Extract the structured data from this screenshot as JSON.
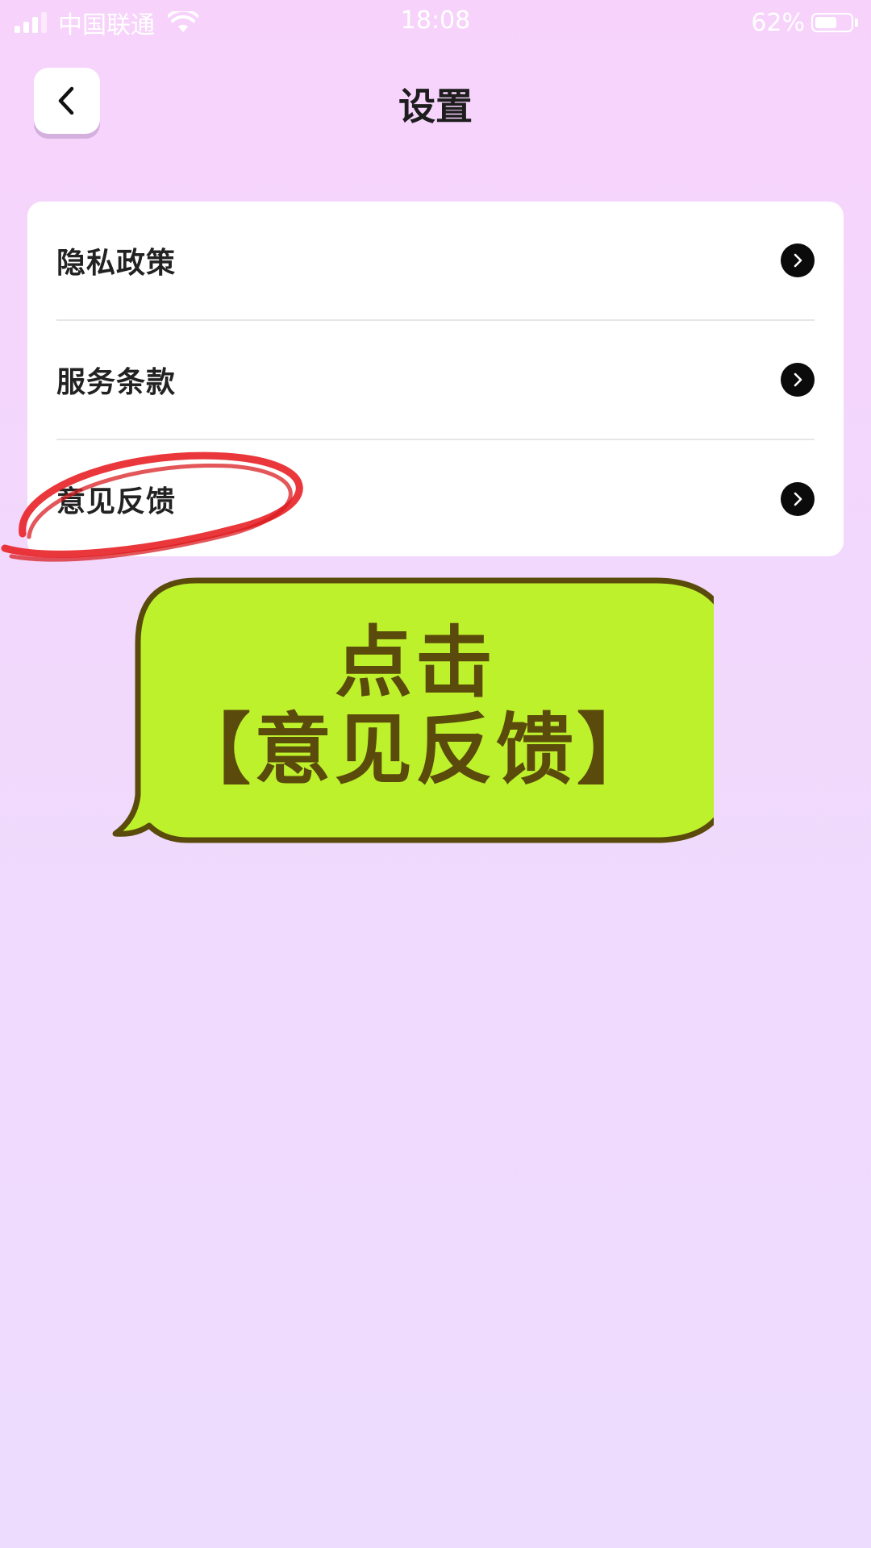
{
  "status_bar": {
    "carrier": "中国联通",
    "time": "18:08",
    "battery_percent": "62%",
    "battery_level": 0.62,
    "icons": [
      "signal-icon",
      "wifi-icon",
      "battery-icon"
    ]
  },
  "header": {
    "title": "设置",
    "back_icon": "chevron-left-icon"
  },
  "settings": {
    "items": [
      {
        "label": "隐私政策",
        "icon": "chevron-right-icon"
      },
      {
        "label": "服务条款",
        "icon": "chevron-right-icon"
      },
      {
        "label": "意见反馈",
        "icon": "chevron-right-icon"
      }
    ]
  },
  "callout": {
    "line1": "点击",
    "line2": "【意见反馈】"
  },
  "colors": {
    "background_top": "#f7d3fb",
    "background_bottom": "#eedcff",
    "card": "#ffffff",
    "bubble_fill": "#bdf12c",
    "bubble_outline": "#5a4a0b",
    "highlight": "#e8262a",
    "chevron": "#0b0b0b"
  }
}
